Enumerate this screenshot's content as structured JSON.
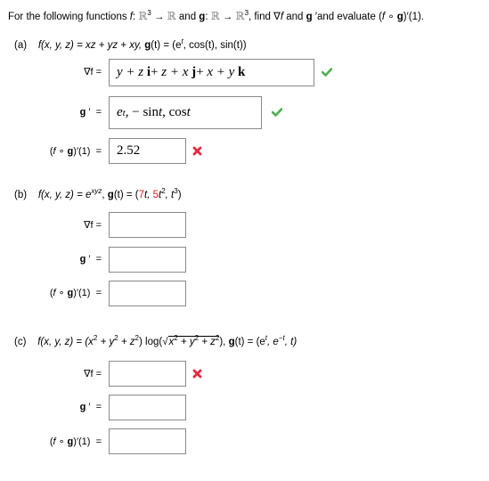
{
  "header": {
    "intro_prefix": "For the following functions ",
    "f_sym": "f",
    "colon": ": ",
    "R": "ℝ",
    "three": "3",
    "arrow": " → ",
    "and": " and ",
    "g_sym": "g",
    "find_text": ", find ∇",
    "f2": "f",
    "and2": " and ",
    "g2": "g",
    "prime_and": " ′and evaluate ",
    "comp_open": "(",
    "comp_f": "f",
    "comp_o": " ∘ ",
    "comp_g": "g",
    "comp_close": ")′(1)."
  },
  "labels": {
    "grad": "∇f  =",
    "gprime": "g ′  =",
    "comp": "(f ∘ g)′(1)  ="
  },
  "parts": [
    {
      "tag": "(a)",
      "f_def": "f(x, y, z) = xz + yz + xy,",
      "g_def_prefix": "g",
      "g_def": "(t) = (e",
      "g_sup": "t",
      "g_def_rest": ", cos(t), sin(t))",
      "grad_answer": {
        "t1": "y + z",
        "u1": "i",
        "p1": " + ",
        "t2": "z + x",
        "u2": "j",
        "p2": " + ",
        "t3": "x + y",
        "u3": "k"
      },
      "grad_status": "correct",
      "gprime_answer": {
        "e": "e",
        "esup": "t",
        "rest1": ",  − sin ",
        "t1": "t",
        "rest2": " ,  cos ",
        "t2": "t"
      },
      "gprime_status": "correct",
      "comp_answer": "2.52",
      "comp_status": "incorrect"
    },
    {
      "tag": "(b)",
      "f_def": "f(x, y, z) = e",
      "f_sup": "xyz",
      "g_prefix": ", ",
      "g_sym": "g",
      "g_def": "(t) = (",
      "red1": "7",
      "mid1": "t, ",
      "red2": "5",
      "mid2": "t",
      "sup2": "2",
      "mid3": ", t",
      "sup3": "3",
      "close": ")",
      "grad_answer": "",
      "gprime_answer": "",
      "comp_answer": ""
    },
    {
      "tag": "(c)",
      "f_def": "f(x, y, z) = (x",
      "s1": "2",
      "p1": " + y",
      "s2": "2",
      "p2": " + z",
      "s3": "2",
      "p3": ") log(",
      "sq_x": "x",
      "sq_s1": "2",
      "sq_p1": " + y",
      "sq_s2": "2",
      "sq_p2": " + z",
      "sq_s3": "2",
      "p4": "), ",
      "g_sym": "g",
      "g_def": "(t) = (e",
      "g_s1": "t",
      "g_mid": ", e",
      "g_s2": "−t",
      "g_end": ", t)",
      "grad_answer": "",
      "grad_status": "incorrect",
      "gprime_answer": "",
      "comp_answer": ""
    }
  ],
  "colors": {
    "correct": "#4caf50",
    "incorrect": "#e8263e",
    "highlight": "#e0201f"
  }
}
